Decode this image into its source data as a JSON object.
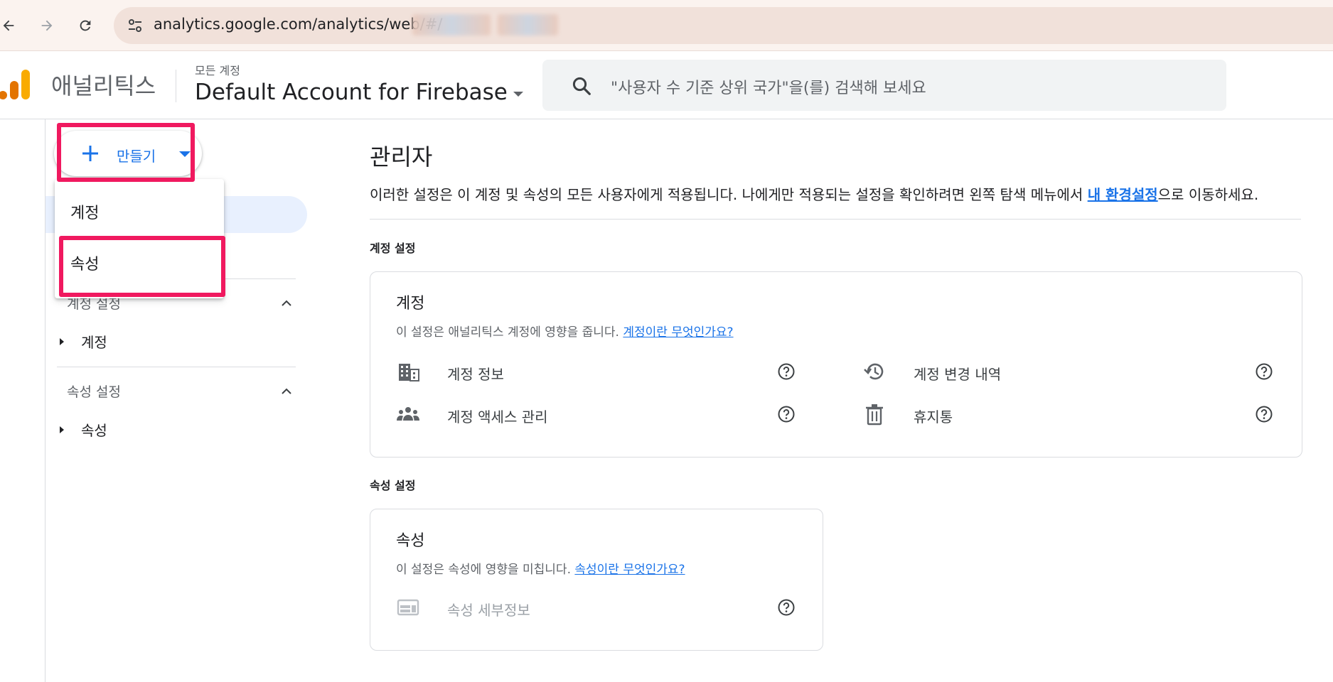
{
  "browser": {
    "url": "analytics.google.com/analytics/web/#/"
  },
  "header": {
    "app_name": "애널리틱스",
    "account_caption": "모든 계정",
    "account_name": "Default Account for Firebase",
    "search_placeholder": "\"사용자 수 기준 상위 국가\"을(를) 검색해 보세요"
  },
  "sidebar": {
    "create_label": "만들기",
    "sections": [
      {
        "label": "계정 설정",
        "item": "계정"
      },
      {
        "label": "속성 설정",
        "item": "속성"
      }
    ]
  },
  "dropdown": {
    "items": [
      "계정",
      "속성"
    ]
  },
  "main": {
    "title": "관리자",
    "description_prefix": "이러한 설정은 이 계정 및 속성의 모든 사용자에게 적용됩니다. 나에게만 적용되는 설정을 확인하려면 왼쪽 탐색 메뉴에서 ",
    "description_link": "내 환경설정",
    "description_suffix": "으로 이동하세요.",
    "account_section_caption": "계정 설정",
    "account_card": {
      "title": "계정",
      "desc_prefix": "이 설정은 애널리틱스 계정에 영향을 줍니다. ",
      "desc_link": "계정이란 무엇인가요?",
      "rows": [
        {
          "label": "계정 정보",
          "icon": "building-icon"
        },
        {
          "label": "계정 변경 내역",
          "icon": "history-icon"
        },
        {
          "label": "계정 액세스 관리",
          "icon": "people-icon"
        },
        {
          "label": "휴지통",
          "icon": "trash-icon"
        }
      ]
    },
    "property_section_caption": "속성 설정",
    "property_card": {
      "title": "속성",
      "desc_prefix": "이 설정은 속성에 영향을 미칩니다. ",
      "desc_link": "속성이란 무엇인가요?",
      "rows": [
        {
          "label": "속성 세부정보",
          "icon": "web-card-icon"
        }
      ]
    }
  },
  "colors": {
    "accent": "#1a73e8",
    "highlight": "#f0195f",
    "logo_orange": "#e37400",
    "logo_yellow": "#f9ab00"
  }
}
